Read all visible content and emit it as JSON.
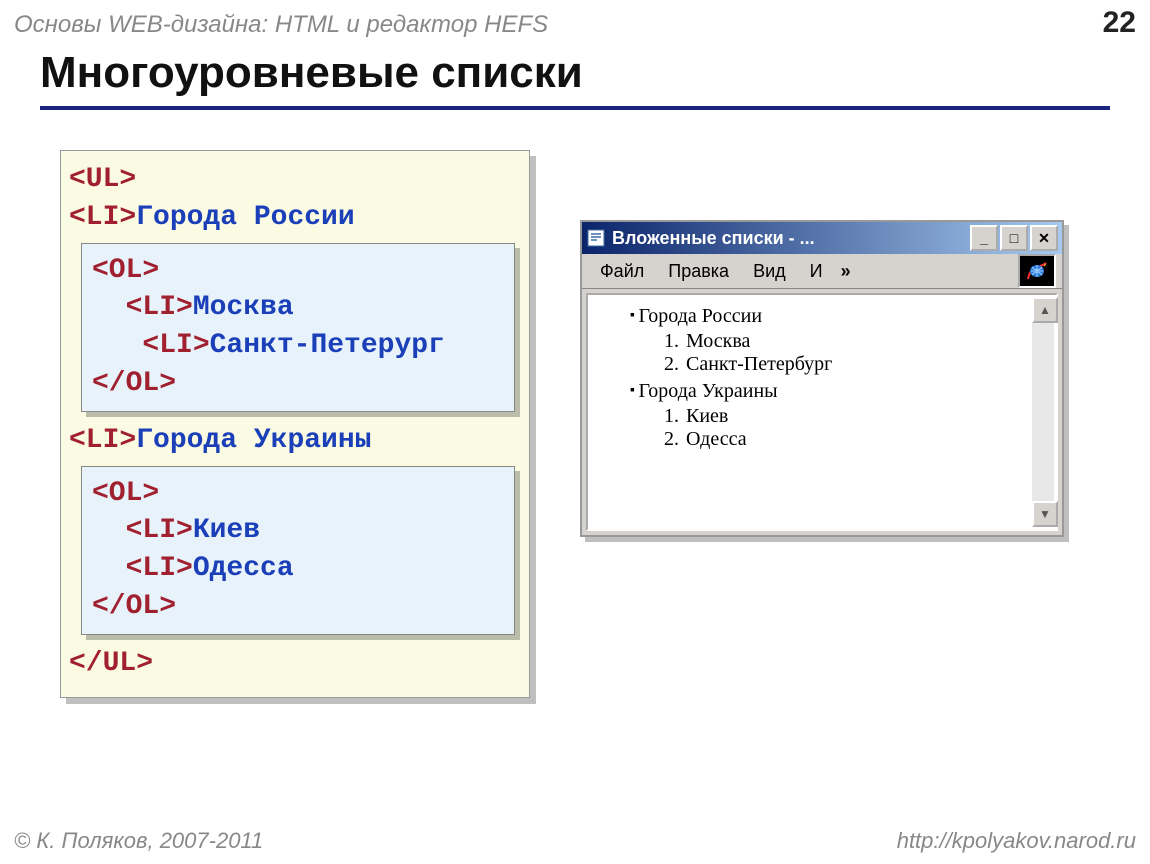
{
  "header": {
    "course": "Основы WEB-дизайна: HTML и редактор HEFS",
    "page": "22"
  },
  "title": "Многоуровневые списки",
  "code": {
    "ul_open": "<UL>",
    "li1": "<LI>",
    "li1_text": "Города России",
    "ol_open": "<OL>",
    "li_inner": "  <LI>",
    "city1": "Москва",
    "li_inner2": "   <LI>",
    "city2": "Санкт-Петерург",
    "ol_close": "</OL>",
    "li2": "<LI>",
    "li2_text": "Города Украины",
    "city3": "Киев",
    "city4": "Одесса",
    "ul_close": "</UL>"
  },
  "browser": {
    "title": "Вложенные списки - ...",
    "menu": {
      "file": "Файл",
      "edit": "Правка",
      "view": "Вид",
      "fav": "И",
      "more": "»"
    },
    "winbtns": {
      "min": "_",
      "max": "□",
      "close": "✕"
    },
    "content": {
      "g1": "Города России",
      "g1_items": {
        "i1": "Москва",
        "i2": "Санкт-Петербург"
      },
      "g2": "Города Украины",
      "g2_items": {
        "i1": "Киев",
        "i2": "Одесса"
      }
    }
  },
  "footer": {
    "left": "© К. Поляков, 2007-2011",
    "right": "http://kpolyakov.narod.ru"
  }
}
